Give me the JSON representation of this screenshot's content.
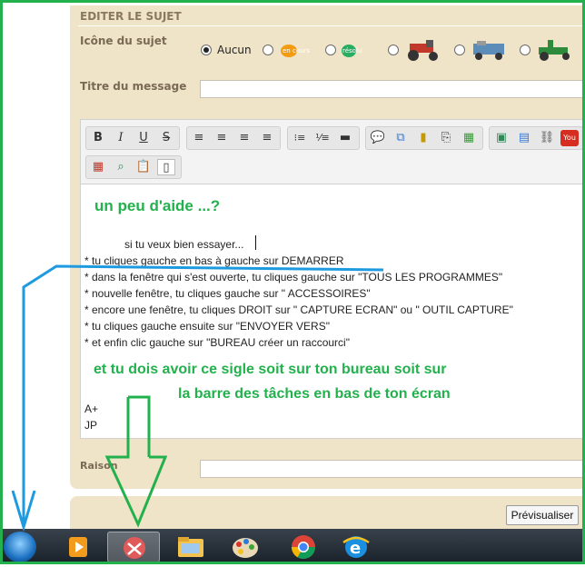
{
  "section_title": "EDITER LE SUJET",
  "icon_label": "Icône du sujet",
  "radio_options": [
    {
      "label": "Aucun",
      "checked": true
    },
    {
      "label": "en cours",
      "checked": false
    },
    {
      "label": "résolu",
      "checked": false
    },
    {
      "label": "",
      "checked": false
    },
    {
      "label": "",
      "checked": false
    },
    {
      "label": "",
      "checked": false
    }
  ],
  "title_label": "Titre du message",
  "title_value": "",
  "toolbar": {
    "bold": "B",
    "italic": "I",
    "underline": "U",
    "strike": "S"
  },
  "editor": {
    "heading": "un peu d'aide ...?",
    "lines": [
      "si tu veux bien essayer...",
      "* tu cliques gauche en bas à gauche sur DEMARRER",
      "* dans la fenêtre qui s'est ouverte, tu cliques gauche sur \"TOUS LES PROGRAMMES\"",
      "* nouvelle fenêtre, tu cliques gauche sur \" ACCESSOIRES\"",
      "* encore une  fenêtre, tu cliques DROIT sur \" CAPTURE ECRAN\" ou \" OUTIL CAPTURE\"",
      "* tu cliques gauche ensuite sur \"ENVOYER VERS\"",
      "* et enfin clic gauche sur \"BUREAU créer un raccourci\""
    ],
    "note_line1": "et tu dois avoir ce sigle soit sur ton bureau soit sur",
    "note_line2": "la barre des tâches en bas de ton écran",
    "sign1": "A+",
    "sign2": "JP"
  },
  "raison_label": "Raison",
  "raison_value": "",
  "preview_button": "Prévisualiser",
  "colors": {
    "panel": "#efe4c8",
    "annotation_green": "#22b14c",
    "annotation_blue": "#1e9be0"
  }
}
